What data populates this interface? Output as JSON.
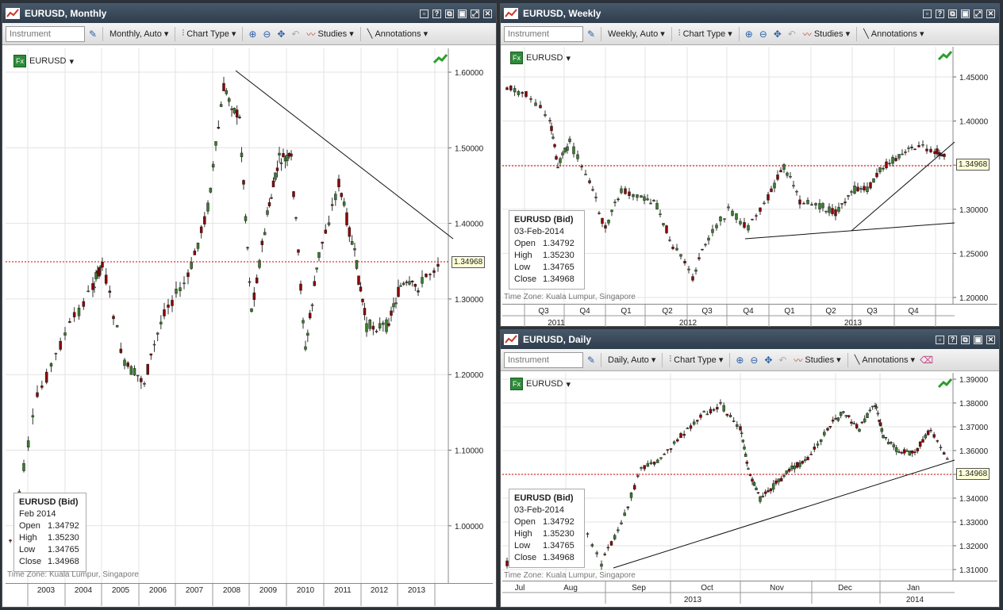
{
  "colors": {
    "up": "#3a7d2c",
    "down": "#8b0000",
    "grid": "#e3e3e3",
    "bid_line": "#cc0000"
  },
  "panels": {
    "monthly": {
      "title": "EURUSD, Monthly",
      "toolbar": {
        "instrument_placeholder": "Instrument",
        "timeframe": "Monthly,  Auto",
        "chart_type": "Chart Type",
        "studies": "Studies",
        "annotations": "Annotations"
      },
      "symbol": "EURUSD",
      "info": {
        "title": "EURUSD (Bid)",
        "date": "Feb 2014",
        "open_label": "Open",
        "open": "1.34792",
        "high_label": "High",
        "high": "1.35230",
        "low_label": "Low",
        "low": "1.34765",
        "close_label": "Close",
        "close": "1.34968"
      },
      "timezone": "Time Zone: Kuala Lumpur, Singapore",
      "price_tag": "1.34968",
      "y_labels": [
        "1.60000",
        "1.50000",
        "1.40000",
        "1.30000",
        "1.20000",
        "1.10000",
        "1.00000"
      ],
      "x_labels": [
        "2003",
        "2004",
        "2005",
        "2006",
        "2007",
        "2008",
        "2009",
        "2010",
        "2011",
        "2012",
        "2013"
      ]
    },
    "weekly": {
      "title": "EURUSD, Weekly",
      "toolbar": {
        "instrument_placeholder": "Instrument",
        "timeframe": "Weekly,  Auto",
        "chart_type": "Chart Type",
        "studies": "Studies",
        "annotations": "Annotations"
      },
      "symbol": "EURUSD",
      "info": {
        "title": "EURUSD (Bid)",
        "date": "03-Feb-2014",
        "open_label": "Open",
        "open": "1.34792",
        "high_label": "High",
        "high": "1.35230",
        "low_label": "Low",
        "low": "1.34765",
        "close_label": "Close",
        "close": "1.34968"
      },
      "timezone": "Time Zone: Kuala Lumpur, Singapore",
      "price_tag": "1.34968",
      "y_labels": [
        "1.45000",
        "1.40000",
        "1.35000",
        "1.30000",
        "1.25000",
        "1.20000"
      ],
      "x_labels": [
        "Q3",
        "Q4",
        "Q1",
        "Q2",
        "Q3",
        "Q4",
        "Q1",
        "Q2",
        "Q3",
        "Q4"
      ],
      "year_labels": [
        "2011",
        "2012",
        "2013"
      ]
    },
    "daily": {
      "title": "EURUSD, Daily",
      "toolbar": {
        "instrument_placeholder": "Instrument",
        "timeframe": "Daily,  Auto",
        "chart_type": "Chart Type",
        "studies": "Studies",
        "annotations": "Annotations"
      },
      "symbol": "EURUSD",
      "info": {
        "title": "EURUSD (Bid)",
        "date": "03-Feb-2014",
        "open_label": "Open",
        "open": "1.34792",
        "high_label": "High",
        "high": "1.35230",
        "low_label": "Low",
        "low": "1.34765",
        "close_label": "Close",
        "close": "1.34968"
      },
      "timezone": "Time Zone: Kuala Lumpur, Singapore",
      "price_tag": "1.34968",
      "y_labels": [
        "1.39000",
        "1.38000",
        "1.37000",
        "1.36000",
        "1.35000",
        "1.34000",
        "1.33000",
        "1.32000",
        "1.31000"
      ],
      "x_labels": [
        "Jul",
        "Aug",
        "Sep",
        "Oct",
        "Nov",
        "Dec",
        "Jan"
      ],
      "year_labels": [
        "2013",
        "2014"
      ]
    }
  }
}
